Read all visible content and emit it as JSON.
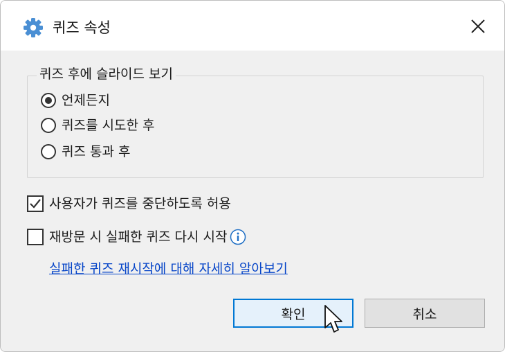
{
  "window": {
    "title": "퀴즈 속성"
  },
  "group": {
    "legend": "퀴즈 후에 슬라이드 보기",
    "options": [
      {
        "label": "언제든지",
        "checked": true
      },
      {
        "label": "퀴즈를 시도한 후",
        "checked": false
      },
      {
        "label": "퀴즈 통과 후",
        "checked": false
      }
    ]
  },
  "checkboxes": [
    {
      "label": "사용자가 퀴즈를 중단하도록 허용",
      "checked": true
    },
    {
      "label": "재방문 시 실패한 퀴즈 다시 시작",
      "checked": false
    }
  ],
  "help_link": "실패한 퀴즈 재시작에 대해 자세히 알아보기",
  "buttons": {
    "ok": "확인",
    "cancel": "취소"
  },
  "icons": {
    "title": "gear-icon",
    "close": "close-icon",
    "info": "info-icon",
    "cursor": "mouse-cursor-icon"
  },
  "colors": {
    "accent": "#0078d4",
    "link": "#0645c8",
    "icon_blue": "#4a8fd4",
    "client_bg": "#f0f0f0"
  }
}
